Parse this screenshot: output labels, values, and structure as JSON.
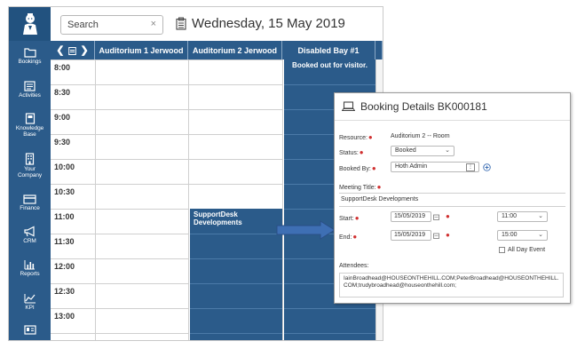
{
  "search": {
    "placeholder": "Search",
    "clear_icon": "close-icon"
  },
  "header": {
    "date": "Wednesday, 15 May 2019",
    "calendar_icon": "calendar-icon"
  },
  "sidebar": {
    "items": [
      {
        "label": "Bookings",
        "icon": "folder-icon"
      },
      {
        "label": "Activities",
        "icon": "list-icon"
      },
      {
        "label": "Knowledge\nBase",
        "icon": "book-icon"
      },
      {
        "label": "Your\nCompany",
        "icon": "building-icon"
      },
      {
        "label": "Finance",
        "icon": "card-icon"
      },
      {
        "label": "CRM",
        "icon": "megaphone-icon"
      },
      {
        "label": "Reports",
        "icon": "bar-chart-icon"
      },
      {
        "label": "KPI",
        "icon": "line-chart-icon"
      }
    ]
  },
  "grid": {
    "nav": {
      "prev": "❮",
      "next": "❯"
    },
    "columns": [
      "Auditorium 1 Jerwood",
      "Auditorium 2 Jerwood",
      "Disabled Bay #1"
    ],
    "times": [
      "8:00",
      "8:30",
      "9:00",
      "9:30",
      "10:00",
      "10:30",
      "11:00",
      "11:30",
      "12:00",
      "12:30",
      "13:00"
    ],
    "bookings": {
      "disabled_bay": "Booked out for visitor.",
      "auditorium2": "SupportDesk Developments"
    }
  },
  "dialog": {
    "title": "Booking Details BK000181",
    "resource_label": "Resource:",
    "resource_value": "Auditorium 2 -- Room",
    "status_label": "Status:",
    "status_value": "Booked",
    "booked_by_label": "Booked By:",
    "booked_by_value": "Hoth Admin",
    "meeting_title_label": "Meeting Title:",
    "meeting_title_value": "SupportDesk Developments",
    "start_label": "Start:",
    "start_date": "15/05/2019",
    "start_time": "11:00",
    "end_label": "End:",
    "end_date": "15/05/2019",
    "end_time": "15:00",
    "all_day_label": "All Day Event",
    "attendees_label": "Attendees:",
    "attendees_value": "IainBroadhead@HOUSEONTHEHILL.COM;PeterBroadhead@HOUSEONTHEHILL.COM;trudybroadhead@houseonthehill.com;"
  },
  "colors": {
    "accent": "#2b5b8a",
    "required": "#d03030"
  }
}
